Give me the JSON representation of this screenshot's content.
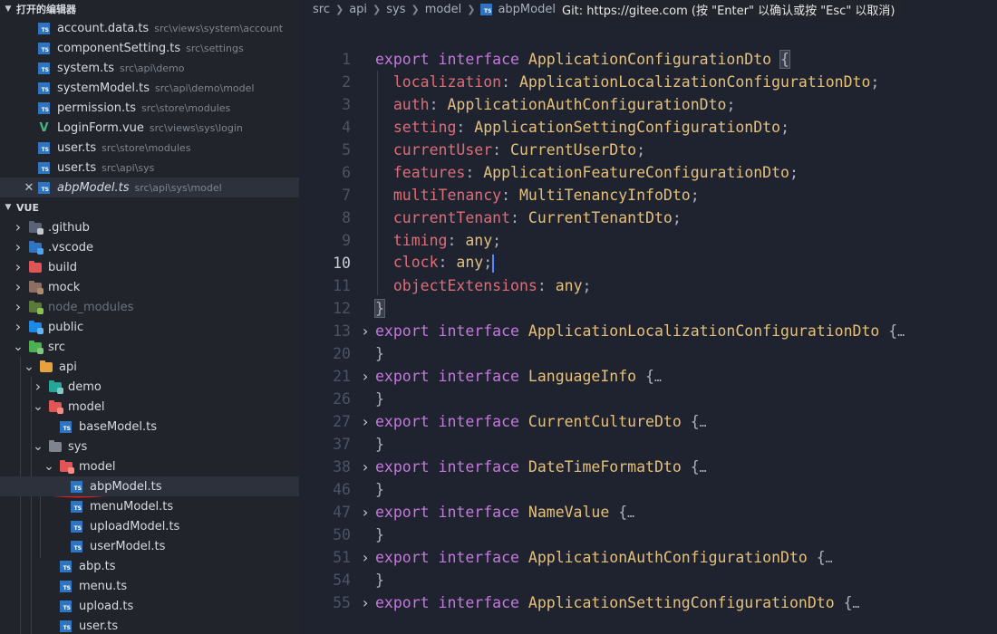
{
  "sidebar": {
    "open_editors_header": "打开的编辑器",
    "open_editors": [
      {
        "name": "account.data.ts",
        "path": "src\\views\\system\\account",
        "type": "ts"
      },
      {
        "name": "componentSetting.ts",
        "path": "src\\settings",
        "type": "ts"
      },
      {
        "name": "system.ts",
        "path": "src\\api\\demo",
        "type": "ts"
      },
      {
        "name": "systemModel.ts",
        "path": "src\\api\\demo\\model",
        "type": "ts"
      },
      {
        "name": "permission.ts",
        "path": "src\\store\\modules",
        "type": "ts"
      },
      {
        "name": "LoginForm.vue",
        "path": "src\\views\\sys\\login",
        "type": "vue"
      },
      {
        "name": "user.ts",
        "path": "src\\store\\modules",
        "type": "ts"
      },
      {
        "name": "user.ts",
        "path": "src\\api\\sys",
        "type": "ts"
      },
      {
        "name": "abpModel.ts",
        "path": "src\\api\\sys\\model",
        "type": "ts",
        "close": "✕"
      }
    ],
    "project_header": "VUE",
    "tree": [
      {
        "label": ".github",
        "depth": 0
      },
      {
        "label": ".vscode",
        "depth": 0
      },
      {
        "label": "build",
        "depth": 0
      },
      {
        "label": "mock",
        "depth": 0
      },
      {
        "label": "node_modules",
        "depth": 0
      },
      {
        "label": "public",
        "depth": 0
      },
      {
        "label": "src",
        "depth": 0
      },
      {
        "label": "api",
        "depth": 1
      },
      {
        "label": "demo",
        "depth": 2
      },
      {
        "label": "model",
        "depth": 2
      },
      {
        "label": "baseModel.ts",
        "depth": 3
      },
      {
        "label": "sys",
        "depth": 2
      },
      {
        "label": "model",
        "depth": 3
      },
      {
        "label": "abpModel.ts",
        "depth": 4
      },
      {
        "label": "menuModel.ts",
        "depth": 4
      },
      {
        "label": "uploadModel.ts",
        "depth": 4
      },
      {
        "label": "userModel.ts",
        "depth": 4
      },
      {
        "label": "abp.ts",
        "depth": 3
      },
      {
        "label": "menu.ts",
        "depth": 3
      },
      {
        "label": "upload.ts",
        "depth": 3
      },
      {
        "label": "user.ts",
        "depth": 3
      }
    ]
  },
  "breadcrumb": [
    "src",
    "api",
    "sys",
    "model",
    "abpModel.ts"
  ],
  "git_tooltip": "Git: https://gitee.com (按 \"Enter\" 以确认或按 \"Esc\" 以取消)",
  "icons": {
    "ts": "ts-file-icon",
    "vue": "vue-file-icon",
    "folder": "folder-icon",
    "chevron_right": "chevron-right-icon",
    "chevron_down": "chevron-down-icon",
    "close": "close-icon",
    "fold": "fold-chevron-icon"
  },
  "colors": {
    "keyword": "#c678dd",
    "type": "#e5c07b",
    "property": "#e06c75",
    "punct": "#abb2bf",
    "cursor": "#528bff",
    "sidebar_bg": "#21252b",
    "editor_bg": "#1f2330"
  },
  "code": {
    "lines": [
      {
        "n": "1",
        "tokens": [
          [
            "export",
            "kw"
          ],
          [
            " ",
            "pu"
          ],
          [
            "interface",
            "kw"
          ],
          [
            " ",
            "pu"
          ],
          [
            "ApplicationConfigurationDto",
            "ty"
          ],
          [
            " ",
            "pu"
          ],
          [
            "{",
            "pu brace-hl"
          ]
        ]
      },
      {
        "n": "2",
        "tokens": [
          [
            "  ",
            "pu"
          ],
          [
            "localization",
            "pr"
          ],
          [
            ": ",
            "pu"
          ],
          [
            "ApplicationLocalizationConfigurationDto",
            "ty"
          ],
          [
            ";",
            "pu"
          ]
        ]
      },
      {
        "n": "3",
        "tokens": [
          [
            "  ",
            "pu"
          ],
          [
            "auth",
            "pr"
          ],
          [
            ": ",
            "pu"
          ],
          [
            "ApplicationAuthConfigurationDto",
            "ty"
          ],
          [
            ";",
            "pu"
          ]
        ]
      },
      {
        "n": "4",
        "tokens": [
          [
            "  ",
            "pu"
          ],
          [
            "setting",
            "pr"
          ],
          [
            ": ",
            "pu"
          ],
          [
            "ApplicationSettingConfigurationDto",
            "ty"
          ],
          [
            ";",
            "pu"
          ]
        ]
      },
      {
        "n": "5",
        "tokens": [
          [
            "  ",
            "pu"
          ],
          [
            "currentUser",
            "pr"
          ],
          [
            ": ",
            "pu"
          ],
          [
            "CurrentUserDto",
            "ty"
          ],
          [
            ";",
            "pu"
          ]
        ]
      },
      {
        "n": "6",
        "tokens": [
          [
            "  ",
            "pu"
          ],
          [
            "features",
            "pr"
          ],
          [
            ": ",
            "pu"
          ],
          [
            "ApplicationFeatureConfigurationDto",
            "ty"
          ],
          [
            ";",
            "pu"
          ]
        ]
      },
      {
        "n": "7",
        "tokens": [
          [
            "  ",
            "pu"
          ],
          [
            "multiTenancy",
            "pr"
          ],
          [
            ": ",
            "pu"
          ],
          [
            "MultiTenancyInfoDto",
            "ty"
          ],
          [
            ";",
            "pu"
          ]
        ]
      },
      {
        "n": "8",
        "tokens": [
          [
            "  ",
            "pu"
          ],
          [
            "currentTenant",
            "pr"
          ],
          [
            ": ",
            "pu"
          ],
          [
            "CurrentTenantDto",
            "ty"
          ],
          [
            ";",
            "pu"
          ]
        ]
      },
      {
        "n": "9",
        "tokens": [
          [
            "  ",
            "pu"
          ],
          [
            "timing",
            "pr"
          ],
          [
            ": ",
            "pu"
          ],
          [
            "any",
            "any"
          ],
          [
            ";",
            "pu"
          ]
        ]
      },
      {
        "n": "10",
        "active": true,
        "tokens": [
          [
            "  ",
            "pu"
          ],
          [
            "clock",
            "pr"
          ],
          [
            ": ",
            "pu"
          ],
          [
            "any",
            "any"
          ],
          [
            ";",
            "pu"
          ],
          [
            "|",
            "cursor"
          ]
        ]
      },
      {
        "n": "11",
        "tokens": [
          [
            "  ",
            "pu"
          ],
          [
            "objectExtensions",
            "pr"
          ],
          [
            ": ",
            "pu"
          ],
          [
            "any",
            "any"
          ],
          [
            ";",
            "pu"
          ]
        ]
      },
      {
        "n": "12",
        "tokens": [
          [
            "}",
            "pu brace-hl"
          ]
        ]
      },
      {
        "n": "13",
        "fold": true,
        "tokens": [
          [
            "export",
            "kw"
          ],
          [
            " ",
            "pu"
          ],
          [
            "interface",
            "kw"
          ],
          [
            " ",
            "pu"
          ],
          [
            "ApplicationLocalizationConfigurationDto",
            "ty"
          ],
          [
            " {",
            "pu"
          ],
          [
            "…",
            "ell"
          ]
        ]
      },
      {
        "n": "20",
        "tokens": [
          [
            "}",
            "pu"
          ]
        ]
      },
      {
        "n": "21",
        "fold": true,
        "tokens": [
          [
            "export",
            "kw"
          ],
          [
            " ",
            "pu"
          ],
          [
            "interface",
            "kw"
          ],
          [
            " ",
            "pu"
          ],
          [
            "LanguageInfo",
            "ty"
          ],
          [
            " {",
            "pu"
          ],
          [
            "…",
            "ell"
          ]
        ]
      },
      {
        "n": "26",
        "tokens": [
          [
            "}",
            "pu"
          ]
        ]
      },
      {
        "n": "27",
        "fold": true,
        "tokens": [
          [
            "export",
            "kw"
          ],
          [
            " ",
            "pu"
          ],
          [
            "interface",
            "kw"
          ],
          [
            " ",
            "pu"
          ],
          [
            "CurrentCultureDto",
            "ty"
          ],
          [
            " {",
            "pu"
          ],
          [
            "…",
            "ell"
          ]
        ]
      },
      {
        "n": "37",
        "tokens": [
          [
            "}",
            "pu"
          ]
        ]
      },
      {
        "n": "38",
        "fold": true,
        "tokens": [
          [
            "export",
            "kw"
          ],
          [
            " ",
            "pu"
          ],
          [
            "interface",
            "kw"
          ],
          [
            " ",
            "pu"
          ],
          [
            "DateTimeFormatDto",
            "ty"
          ],
          [
            " {",
            "pu"
          ],
          [
            "…",
            "ell"
          ]
        ]
      },
      {
        "n": "46",
        "tokens": [
          [
            "}",
            "pu"
          ]
        ]
      },
      {
        "n": "47",
        "fold": true,
        "tokens": [
          [
            "export",
            "kw"
          ],
          [
            " ",
            "pu"
          ],
          [
            "interface",
            "kw"
          ],
          [
            " ",
            "pu"
          ],
          [
            "NameValue",
            "ty"
          ],
          [
            " {",
            "pu"
          ],
          [
            "…",
            "ell"
          ]
        ]
      },
      {
        "n": "50",
        "tokens": [
          [
            "}",
            "pu"
          ]
        ]
      },
      {
        "n": "51",
        "fold": true,
        "tokens": [
          [
            "export",
            "kw"
          ],
          [
            " ",
            "pu"
          ],
          [
            "interface",
            "kw"
          ],
          [
            " ",
            "pu"
          ],
          [
            "ApplicationAuthConfigurationDto",
            "ty"
          ],
          [
            " {",
            "pu"
          ],
          [
            "…",
            "ell"
          ]
        ]
      },
      {
        "n": "54",
        "tokens": [
          [
            "}",
            "pu"
          ]
        ]
      },
      {
        "n": "55",
        "fold": true,
        "tokens": [
          [
            "export",
            "kw"
          ],
          [
            " ",
            "pu"
          ],
          [
            "interface",
            "kw"
          ],
          [
            " ",
            "pu"
          ],
          [
            "ApplicationSettingConfigurationDto",
            "ty"
          ],
          [
            " {",
            "pu"
          ],
          [
            "…",
            "ell"
          ]
        ]
      }
    ]
  }
}
